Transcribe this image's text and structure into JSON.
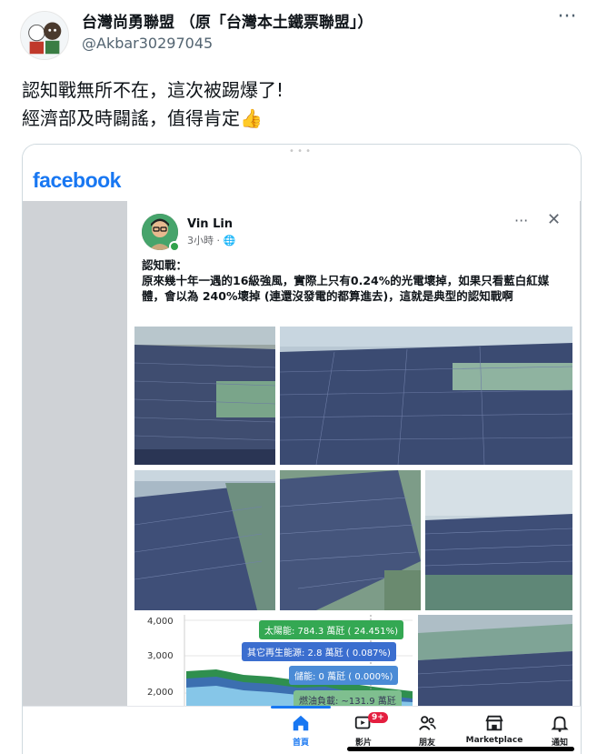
{
  "tweet": {
    "author_name": "台灣尚勇聯盟 （原「台灣本土鐵票聯盟」）",
    "handle": "@Akbar30297045",
    "more_label": "···",
    "text": "認知戰無所不在，這次被踢爆了!\n經濟部及時闢謠，值得肯定👍"
  },
  "card": {
    "brand": "facebook",
    "post": {
      "author": "Vin Lin",
      "time": "3小時 · 🌐",
      "more_label": "···",
      "close_label": "✕",
      "text": "認知戰：\n原來幾十年一遇的16級強風，實際上只有0.24%的光電壞掉，如果只看藍白紅媒體，會以為 240%壞掉 (連還沒發電的都算進去)，這就是典型的認知戰啊"
    },
    "chart": {
      "y_ticks": [
        "4,000",
        "3,000",
        "2,000"
      ],
      "tooltips": [
        {
          "text": "太陽能: 784.3 萬瓩 ( 24.451%)",
          "color": "#34a853"
        },
        {
          "text": "其它再生能源: 2.8 萬瓩 ( 0.087%)",
          "color": "#3b6ecf"
        },
        {
          "text": "儲能: 0 萬瓩 ( 0.000%)",
          "color": "#4b8bd6"
        },
        {
          "text": "燃油負載: ~131.9 萬瓩",
          "color": "#7fbf8f"
        }
      ]
    },
    "nav": [
      {
        "label": "首頁",
        "icon": "home-icon",
        "active": true
      },
      {
        "label": "影片",
        "icon": "video-icon",
        "badge": "9+"
      },
      {
        "label": "朋友",
        "icon": "friends-icon"
      },
      {
        "label": "Marketplace",
        "icon": "marketplace-icon"
      },
      {
        "label": "通知",
        "icon": "bell-icon"
      }
    ]
  },
  "colors": {
    "facebook_blue": "#1877f2",
    "handle_gray": "#536471",
    "online_green": "#31a24c",
    "badge_red": "#e41e3f"
  }
}
